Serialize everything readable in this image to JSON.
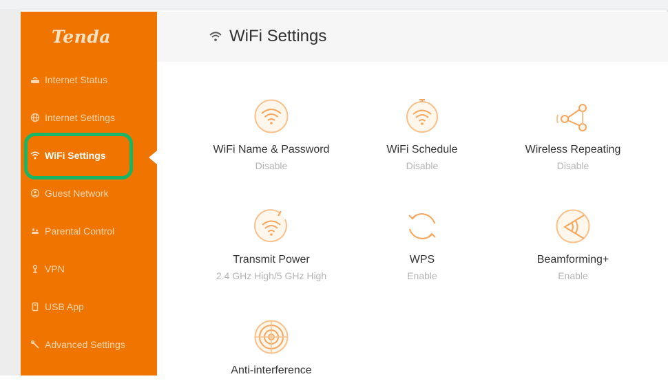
{
  "brand": {
    "logo_text": "Tenda",
    "accent_color": "#f07400",
    "highlight_color": "#17b566"
  },
  "sidebar": {
    "items": [
      {
        "label": "Internet Status",
        "icon": "router-icon",
        "active": false
      },
      {
        "label": "Internet Settings",
        "icon": "globe-icon",
        "active": false
      },
      {
        "label": "WiFi Settings",
        "icon": "wifi-icon",
        "active": true
      },
      {
        "label": "Guest Network",
        "icon": "guest-icon",
        "active": false
      },
      {
        "label": "Parental Control",
        "icon": "family-icon",
        "active": false
      },
      {
        "label": "VPN",
        "icon": "key-icon",
        "active": false
      },
      {
        "label": "USB App",
        "icon": "usb-icon",
        "active": false
      },
      {
        "label": "Advanced Settings",
        "icon": "wrench-icon",
        "active": false
      }
    ]
  },
  "header": {
    "title": "WiFi Settings",
    "icon": "wifi-icon"
  },
  "cards": [
    {
      "title": "WiFi Name & Password",
      "status": "Disable",
      "icon": "wifi-circle-icon"
    },
    {
      "title": "WiFi Schedule",
      "status": "Disable",
      "icon": "wifi-clock-icon"
    },
    {
      "title": "Wireless Repeating",
      "status": "Disable",
      "icon": "repeater-icon"
    },
    {
      "title": "Transmit Power",
      "status": "2.4 GHz High/5 GHz High",
      "icon": "power-wifi-icon"
    },
    {
      "title": "WPS",
      "status": "Enable",
      "icon": "wps-icon"
    },
    {
      "title": "Beamforming+",
      "status": "Enable",
      "icon": "beamforming-icon"
    },
    {
      "title": "Anti-interference",
      "status": "",
      "icon": "target-icon"
    }
  ]
}
